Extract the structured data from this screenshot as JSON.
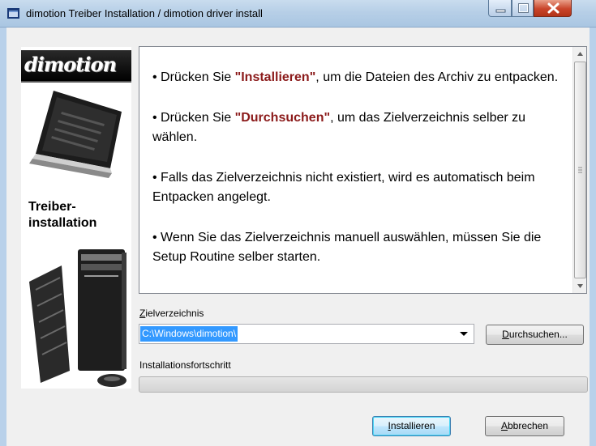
{
  "window": {
    "title": "dimotion Treiber Installation / dimotion driver install"
  },
  "sidebar": {
    "logo_text": "dimotion",
    "caption_line1": "Treiber-",
    "caption_line2": "installation"
  },
  "info": {
    "p1_prefix": "• Drücken Sie ",
    "p1_highlight": "\"Installieren\"",
    "p1_suffix": ", um die Dateien des Archiv zu entpacken.",
    "p2_prefix": "• Drücken Sie ",
    "p2_highlight": "\"Durchsuchen\"",
    "p2_suffix": ", um das Zielverzeichnis selber zu wählen.",
    "p3": "• Falls das Zielverzeichnis nicht existiert, wird es automatisch beim Entpacken angelegt.",
    "p4": "• Wenn Sie das Zielverzeichnis manuell auswählen, müssen Sie die Setup Routine selber starten."
  },
  "target": {
    "label_accel": "Z",
    "label_rest": "ielverzeichnis",
    "value": "C:\\Windows\\dimotion\\"
  },
  "browse_button": {
    "accel": "D",
    "rest": "urchsuchen..."
  },
  "progress": {
    "label": "Installationsfortschritt",
    "value": 0
  },
  "install_button": {
    "accel": "I",
    "rest": "nstallieren"
  },
  "cancel_button": {
    "accel": "A",
    "rest": "bbrechen"
  },
  "colors": {
    "highlight_text": "#8b1a1a",
    "selection": "#3399ff",
    "titlebar": "#b9d1ea"
  }
}
